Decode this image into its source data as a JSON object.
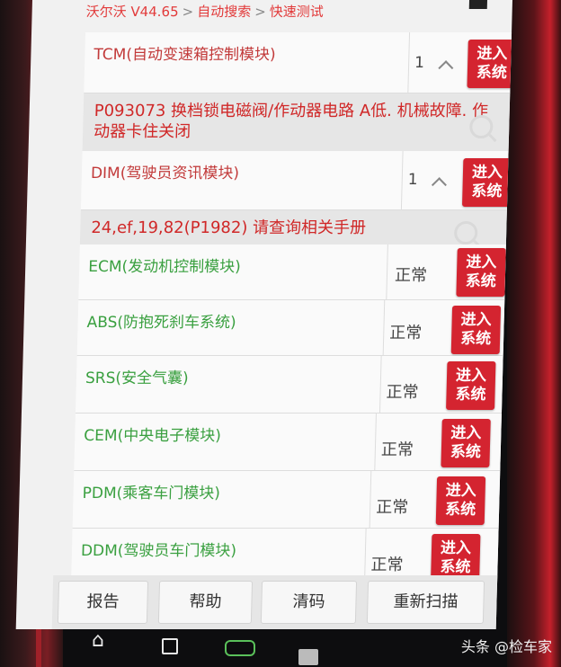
{
  "breadcrumb": {
    "part1": "沃尔沃 V44.65",
    "sep": ">",
    "part2": "自动搜索",
    "part3": "快速测试"
  },
  "enter_label_line1": "进入",
  "enter_label_line2": "系统",
  "modules_faulted": [
    {
      "name": "TCM(自动变速箱控制模块)",
      "count": "1",
      "fault": "P093073 换档锁电磁阀/作动器电路 A低. 机械故障. 作动器卡住关闭"
    },
    {
      "name": "DIM(驾驶员资讯模块)",
      "count": "1",
      "fault": "24,ef,19,82(P1982) 请查询相关手册"
    }
  ],
  "modules_ok": [
    {
      "name": "ECM(发动机控制模块)",
      "status": "正常"
    },
    {
      "name": "ABS(防抱死刹车系统)",
      "status": "正常"
    },
    {
      "name": "SRS(安全气囊)",
      "status": "正常"
    },
    {
      "name": "CEM(中央电子模块)",
      "status": "正常"
    },
    {
      "name": "PDM(乘客车门模块)",
      "status": "正常"
    },
    {
      "name": "DDM(驾驶员车门模块)",
      "status": "正常"
    }
  ],
  "bottom_bar": {
    "report": "报告",
    "help": "帮助",
    "clear": "清码",
    "rescan": "重新扫描"
  },
  "nav": {
    "home_icon": "⌂"
  },
  "watermark": "头条 @检车家",
  "colors": {
    "accent": "#d42430",
    "ok_text": "#3aa040",
    "fault_text": "#d02828"
  }
}
